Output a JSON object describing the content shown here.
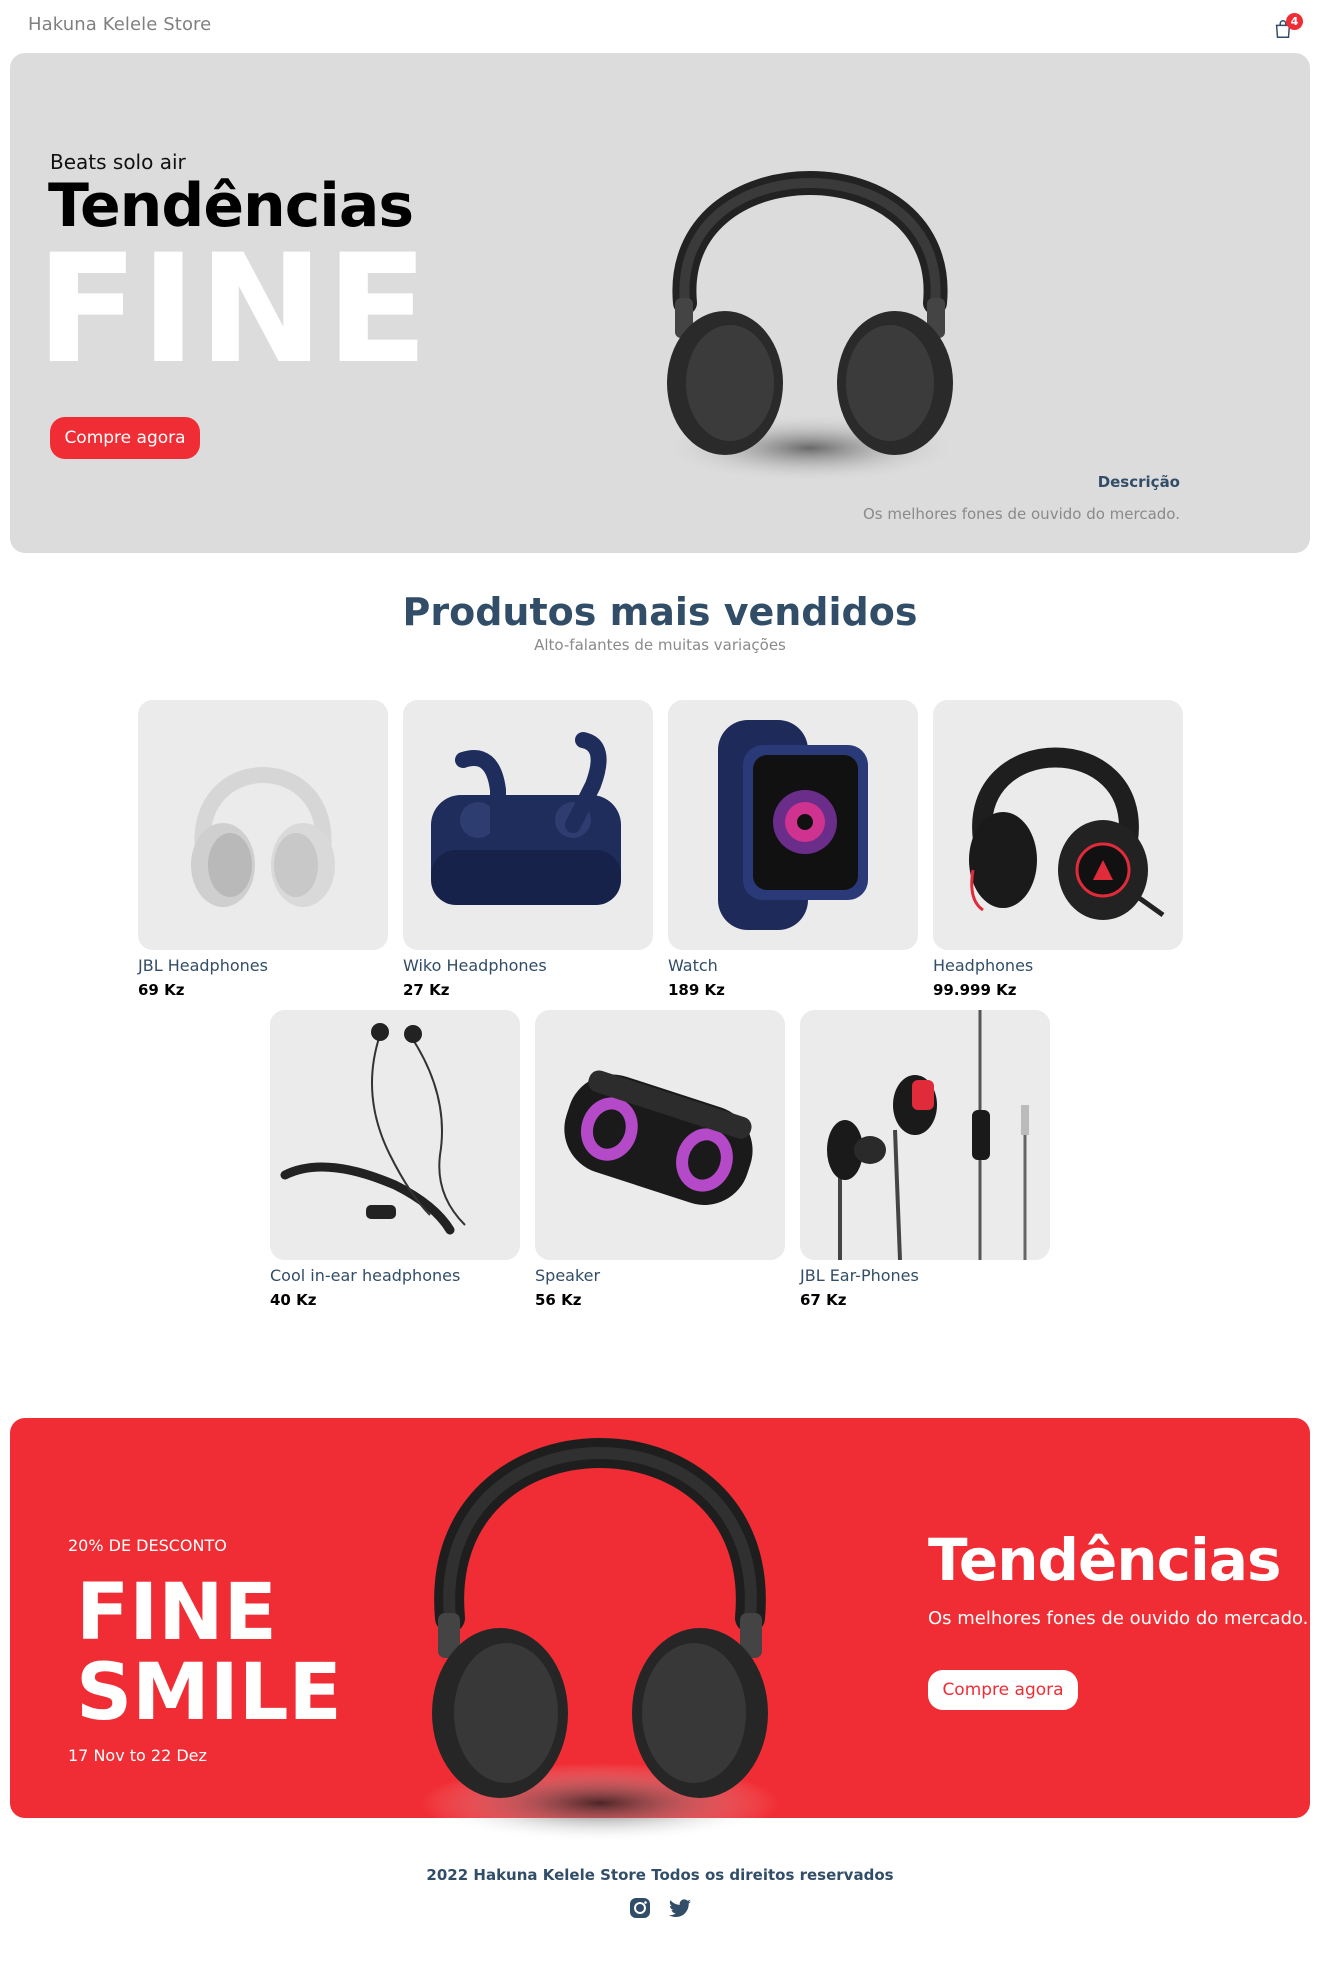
{
  "navbar": {
    "logo": "Hakuna Kelele Store",
    "cart_quantity": "4"
  },
  "hero": {
    "small_text": "Beats solo air",
    "mid_text": "Tendências",
    "large_text": "FINE",
    "button_label": "Compre agora",
    "desc_title": "Descrição",
    "desc_text": "Os melhores fones de ouvido do mercado."
  },
  "products_section": {
    "title": "Produtos mais vendidos",
    "subtitle": "Alto-falantes de muitas variações"
  },
  "products": [
    {
      "name": "JBL Headphones",
      "price": "69 Kz"
    },
    {
      "name": "Wiko Headphones",
      "price": "27 Kz"
    },
    {
      "name": "Watch",
      "price": "189 Kz"
    },
    {
      "name": "Headphones",
      "price": "99.999 Kz"
    },
    {
      "name": "Cool in-ear headphones",
      "price": "40 Kz"
    },
    {
      "name": "Speaker",
      "price": "56 Kz"
    },
    {
      "name": "JBL Ear-Phones",
      "price": "67 Kz"
    }
  ],
  "footer_banner": {
    "discount": "20% DE DESCONTO",
    "large_text1": "FINE",
    "large_text2": "SMILE",
    "sale_time": "17 Nov to 22 Dez",
    "small_text": "Tendências",
    "desc": "Os melhores fones de ouvido do mercado.",
    "button_label": "Compre agora"
  },
  "footer": {
    "copyright": "2022 Hakuna Kelele Store Todos os direitos reservados",
    "icons": [
      "instagram-icon",
      "twitter-icon"
    ]
  },
  "colors": {
    "accent": "#f02d34",
    "text_dark": "#324d67",
    "hero_bg": "#dcdcdc",
    "card_bg": "#ebebeb"
  }
}
